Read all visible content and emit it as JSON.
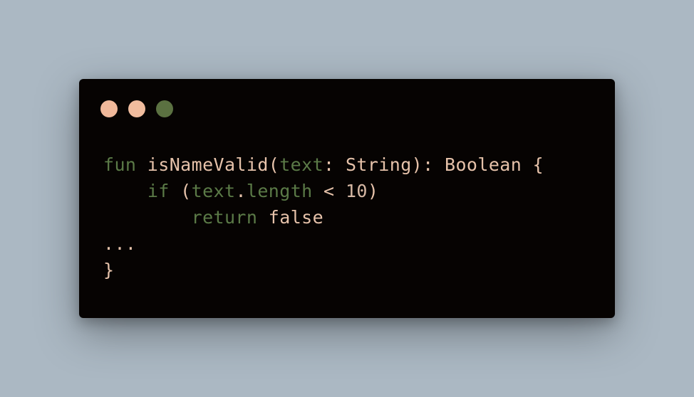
{
  "colors": {
    "background": "#abb8c3",
    "window": "#060302",
    "keyword": "#5b7a47",
    "plain": "#e6c2aa",
    "number": "#d6b8a4"
  },
  "window_controls": [
    {
      "name": "close",
      "color": "#f0b89a"
    },
    {
      "name": "minimize",
      "color": "#f0bc9e"
    },
    {
      "name": "zoom",
      "color": "#5b7141"
    }
  ],
  "code_lines": [
    [
      {
        "text": "fun",
        "kind": "keyword"
      },
      {
        "text": " isNameValid(",
        "kind": "plain"
      },
      {
        "text": "text",
        "kind": "keyword"
      },
      {
        "text": ": String): Boolean {",
        "kind": "plain"
      }
    ],
    [
      {
        "text": "    ",
        "kind": "plain"
      },
      {
        "text": "if",
        "kind": "keyword"
      },
      {
        "text": " (",
        "kind": "plain"
      },
      {
        "text": "text",
        "kind": "keyword"
      },
      {
        "text": ".",
        "kind": "plain"
      },
      {
        "text": "length",
        "kind": "keyword"
      },
      {
        "text": " < ",
        "kind": "plain"
      },
      {
        "text": "10",
        "kind": "number"
      },
      {
        "text": ")",
        "kind": "plain"
      }
    ],
    [
      {
        "text": "        ",
        "kind": "plain"
      },
      {
        "text": "return",
        "kind": "keyword"
      },
      {
        "text": " false",
        "kind": "plain"
      }
    ],
    [
      {
        "text": "...",
        "kind": "plain"
      }
    ],
    [
      {
        "text": "}",
        "kind": "plain"
      }
    ]
  ]
}
